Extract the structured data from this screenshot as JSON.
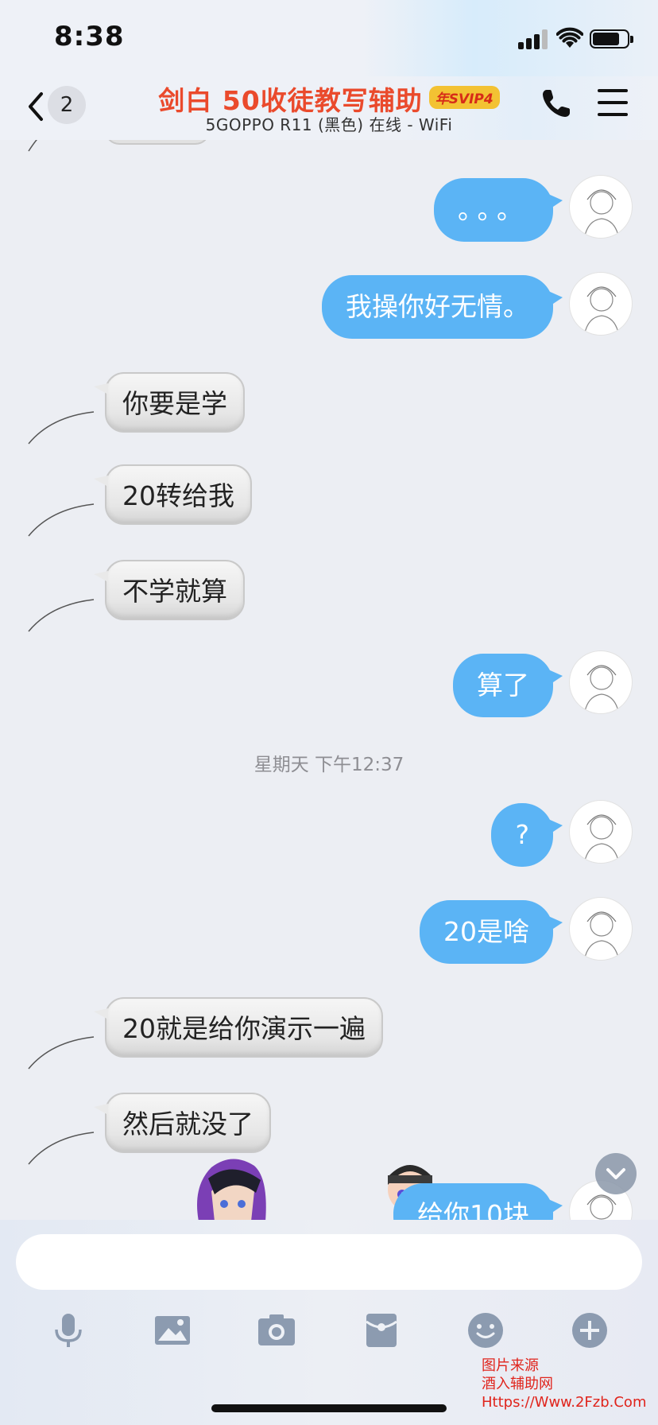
{
  "status_bar": {
    "time": "8:38"
  },
  "header": {
    "unread_count": "2",
    "title": "剑白  50收徒教写辅助",
    "vip_badge": "年SVIP4",
    "subtitle": "5GOPPO R11 (黑色) 在线 - WiFi"
  },
  "messages": [
    {
      "side": "out",
      "text": "。。。"
    },
    {
      "side": "out",
      "text": "我操你好无情。"
    },
    {
      "side": "in",
      "text": "你要是学"
    },
    {
      "side": "in",
      "text": "20转给我"
    },
    {
      "side": "in",
      "text": "不学就算"
    },
    {
      "side": "out",
      "text": "算了"
    },
    {
      "side": "out",
      "text": "?"
    },
    {
      "side": "out",
      "text": "20是啥"
    },
    {
      "side": "in",
      "text": "20就是给你演示一遍"
    },
    {
      "side": "in",
      "text": "然后就没了"
    },
    {
      "side": "out",
      "text": "给你10块"
    }
  ],
  "timestamp": "星期天 下午12:37",
  "input": {
    "value": ""
  },
  "toolbar": [
    "microphone-icon",
    "image-icon",
    "camera-icon",
    "red-packet-icon",
    "emoji-icon",
    "plus-icon"
  ],
  "watermark": {
    "line1": "图片来源",
    "line2": "酒入辅助网",
    "line3": "Https://Www.2Fzb.Com"
  },
  "colors": {
    "outgoing_bubble": "#5bb4f5",
    "title": "#ea4a2c",
    "vip_badge": "#f3c233",
    "watermark": "#e0241c"
  }
}
